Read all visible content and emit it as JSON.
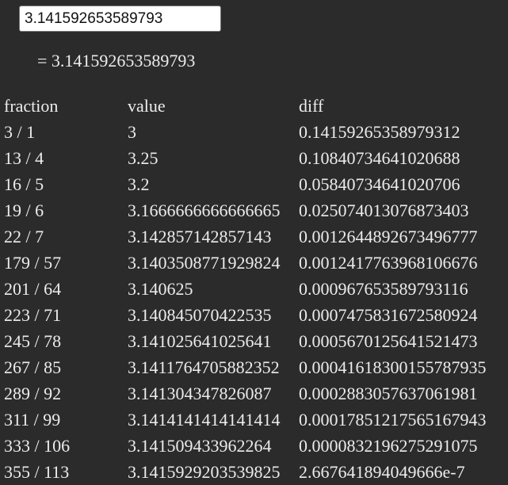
{
  "input": {
    "value": "3.141592653589793"
  },
  "result": {
    "text": "= 3.141592653589793"
  },
  "table": {
    "headers": [
      "fraction",
      "value",
      "diff"
    ],
    "rows": [
      [
        "3 / 1",
        "3",
        "0.14159265358979312"
      ],
      [
        "13 / 4",
        "3.25",
        "0.10840734641020688"
      ],
      [
        "16 / 5",
        "3.2",
        "0.05840734641020706"
      ],
      [
        "19 / 6",
        "3.1666666666666665",
        "0.025074013076873403"
      ],
      [
        "22 / 7",
        "3.142857142857143",
        "0.0012644892673496777"
      ],
      [
        "179 / 57",
        "3.1403508771929824",
        "0.0012417763968106676"
      ],
      [
        "201 / 64",
        "3.140625",
        "0.00096765358979311​6"
      ],
      [
        "223 / 71",
        "3.140845070422535",
        "0.0007475831672580924"
      ],
      [
        "245 / 78",
        "3.141025641025641",
        "0.0005670125641521473"
      ],
      [
        "267 / 85",
        "3.1411764705882352",
        "0.00041618300155787935"
      ],
      [
        "289 / 92",
        "3.141304347826087",
        "0.0002883057637061981"
      ],
      [
        "311 / 99",
        "3.1414141414141414",
        "0.00017851217565167943"
      ],
      [
        "333 / 106",
        "3.141509433962264",
        "0.0000832196275291075"
      ],
      [
        "355 / 113",
        "3.1415929203539825",
        "2.667641894049666e-7"
      ]
    ]
  }
}
